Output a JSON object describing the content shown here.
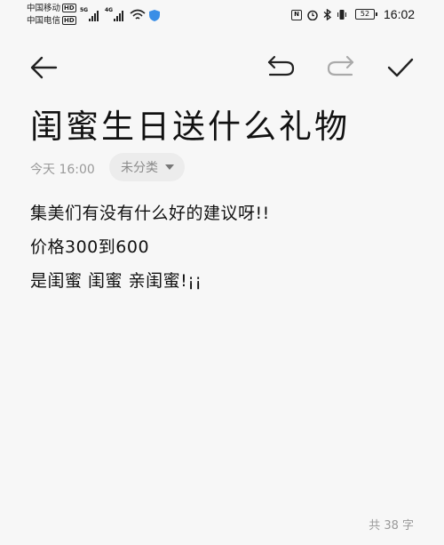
{
  "status_bar": {
    "carrier1": "中国移动",
    "carrier2": "中国电信",
    "hd": "HD",
    "net1": "5G",
    "net2": "4G",
    "nfc": "N",
    "battery": "52",
    "time": "16:02"
  },
  "toolbar": {
    "back_icon": "arrow-left-icon",
    "undo_icon": "undo-icon",
    "redo_icon": "redo-icon",
    "done_icon": "check-icon"
  },
  "note": {
    "title": "闺蜜生日送什么礼物",
    "timestamp": "今天 16:00",
    "category": "未分类",
    "lines": [
      "集美们有没有什么好的建议呀!!",
      "价格300到600",
      "是闺蜜 闺蜜 亲闺蜜!¡¡"
    ],
    "word_count": "共 38 字"
  }
}
